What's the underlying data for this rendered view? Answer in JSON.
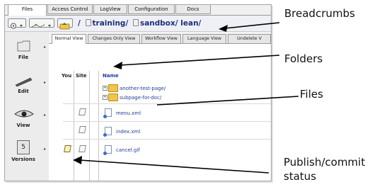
{
  "top_tabs": [
    "Files",
    "Access Control",
    "LogView",
    "Configuration",
    "Docs"
  ],
  "breadcrumb": {
    "sep": "/",
    "parts": [
      "training/",
      "sandbox/",
      "lean/"
    ]
  },
  "sidebar": [
    {
      "label": "File",
      "icon": "folder-icon"
    },
    {
      "label": "Edit",
      "icon": "pen-icon"
    },
    {
      "label": "View",
      "icon": "eye-icon"
    },
    {
      "label": "Versions",
      "icon": "versions-icon",
      "badge": "5"
    }
  ],
  "view_tabs": [
    "Normal View",
    "Changes Only View",
    "Workflow View",
    "Language View",
    "Undelete V"
  ],
  "columns": {
    "you": "You",
    "site": "Site",
    "name": "Name"
  },
  "rows": [
    {
      "name": "another-test-page/",
      "kind": "folder"
    },
    {
      "name": "subpage-for-doc/",
      "kind": "folder"
    },
    {
      "name": "menu.xml",
      "kind": "file"
    },
    {
      "name": "index.xml",
      "kind": "file"
    },
    {
      "name": "cancel.gif",
      "kind": "file"
    }
  ],
  "callouts": {
    "breadcrumbs": "Breadcrumbs",
    "folders": "Folders",
    "files": "Files",
    "publish_line1": "Publish/commit",
    "publish_line2": "status"
  },
  "colors": {
    "link": "#1f3d9a",
    "folder": "#f2c44b",
    "panel": "#ececec"
  }
}
